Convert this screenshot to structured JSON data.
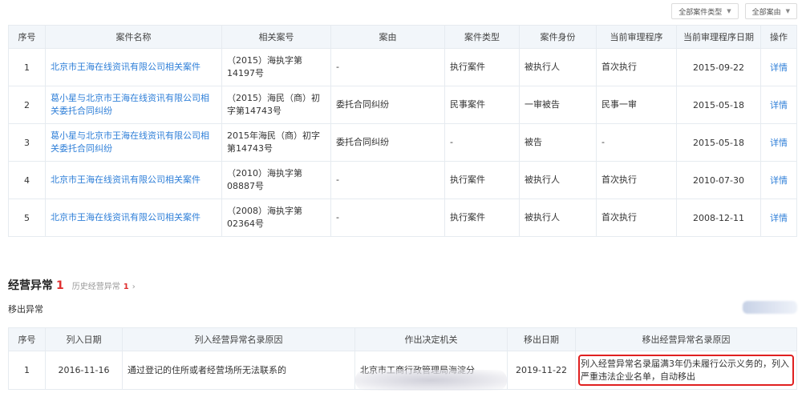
{
  "filters": {
    "case_type_label": "全部案件类型",
    "case_reason_label": "全部案由"
  },
  "cases": {
    "headers": [
      "序号",
      "案件名称",
      "相关案号",
      "案由",
      "案件类型",
      "案件身份",
      "当前审理程序",
      "当前审理程序日期",
      "操作"
    ],
    "rows": [
      {
        "no": "1",
        "name": "北京市王海在线资讯有限公司相关案件",
        "case_no": "（2015）海执字第14197号",
        "reason": "-",
        "type": "执行案件",
        "role": "被执行人",
        "procedure": "首次执行",
        "date": "2015-09-22",
        "action": "详情"
      },
      {
        "no": "2",
        "name": "葛小星与北京市王海在线资讯有限公司相关委托合同纠纷",
        "case_no": "（2015）海民（商）初字第14743号",
        "reason": "委托合同纠纷",
        "type": "民事案件",
        "role": "一审被告",
        "procedure": "民事一审",
        "date": "2015-05-18",
        "action": "详情"
      },
      {
        "no": "3",
        "name": "葛小星与北京市王海在线资讯有限公司相关委托合同纠纷",
        "case_no": "2015年海民（商）初字第14743号",
        "reason": "委托合同纠纷",
        "type": "-",
        "role": "被告",
        "procedure": "-",
        "date": "2015-05-18",
        "action": "详情"
      },
      {
        "no": "4",
        "name": "北京市王海在线资讯有限公司相关案件",
        "case_no": "（2010）海执字第08887号",
        "reason": "-",
        "type": "执行案件",
        "role": "被执行人",
        "procedure": "首次执行",
        "date": "2010-07-30",
        "action": "详情"
      },
      {
        "no": "5",
        "name": "北京市王海在线资讯有限公司相关案件",
        "case_no": "（2008）海执字第02364号",
        "reason": "-",
        "type": "执行案件",
        "role": "被执行人",
        "procedure": "首次执行",
        "date": "2008-12-11",
        "action": "详情"
      }
    ]
  },
  "abnormal_section": {
    "title": "经营异常",
    "count": "1",
    "history_label": "历史经营异常",
    "history_count": "1",
    "history_arrow": "›",
    "sub_title": "移出异常"
  },
  "abnormal_table": {
    "headers": [
      "序号",
      "列入日期",
      "列入经营异常名录原因",
      "作出决定机关",
      "移出日期",
      "移出经营异常名录原因"
    ],
    "rows": [
      {
        "no": "1",
        "list_date": "2016-11-16",
        "list_reason": "通过登记的住所或者经营场所无法联系的",
        "authority": "北京市工商行政管理局海淀分",
        "remove_date": "2019-11-22",
        "remove_reason": "列入经营异常名录届满3年仍未履行公示义务的，列入严重违法企业名单，自动移出"
      }
    ]
  },
  "colors": {
    "link": "#2f7fd8",
    "count_red": "#e03030",
    "highlight_border": "#e02020",
    "header_bg": "#f2f6fa"
  }
}
